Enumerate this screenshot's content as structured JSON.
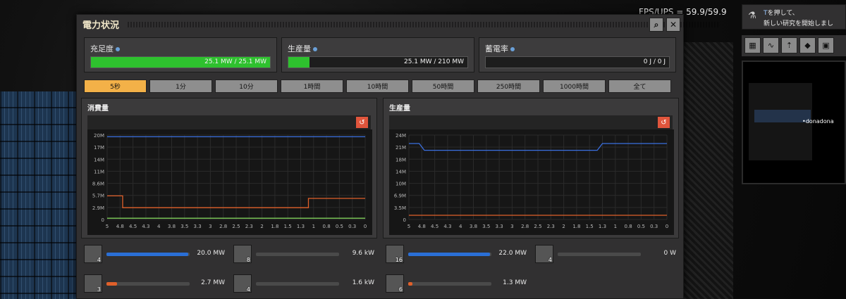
{
  "hud": {
    "fps": "FPS/UPS = 59.9/59.9"
  },
  "window": {
    "title": "電力状況",
    "search_icon": "search-icon",
    "close_icon": "close-icon"
  },
  "stats": {
    "satisfaction": {
      "label": "充足度",
      "value": "25.1 MW / 25.1 MW",
      "fill": 1.0
    },
    "production": {
      "label": "生産量",
      "value": "25.1 MW / 210 MW",
      "fill": 0.12
    },
    "accumulator": {
      "label": "蓄電率",
      "value": "0 J / 0 J",
      "fill": 0.0
    }
  },
  "tabs": [
    "5秒",
    "1分",
    "10分",
    "1時間",
    "10時間",
    "50時間",
    "250時間",
    "1000時間",
    "全て"
  ],
  "active_tab": 0,
  "consumption_graph": {
    "title": "消費量",
    "y_ticks": [
      "20M",
      "17M",
      "14M",
      "11M",
      "8.6M",
      "5.7M",
      "2.9M",
      "0"
    ],
    "x_ticks": [
      "5",
      "4.8",
      "4.5",
      "4.3",
      "4",
      "3.8",
      "3.5",
      "3.3",
      "3",
      "2.8",
      "2.5",
      "2.3",
      "2",
      "1.8",
      "1.5",
      "1.3",
      "1",
      "0.8",
      "0.5",
      "0.3",
      "0"
    ]
  },
  "production_graph": {
    "title": "生産量",
    "y_ticks": [
      "24M",
      "21M",
      "18M",
      "14M",
      "10M",
      "6.9M",
      "3.5M",
      "0"
    ],
    "x_ticks": [
      "5",
      "4.8",
      "4.5",
      "4.3",
      "4",
      "3.8",
      "3.5",
      "3.3",
      "3",
      "2.8",
      "2.5",
      "2.3",
      "2",
      "1.8",
      "1.5",
      "1.3",
      "1",
      "0.8",
      "0.5",
      "0.3",
      "0"
    ]
  },
  "consumers": [
    {
      "icon": "lab-icon",
      "count": "4",
      "value": "20.0 MW",
      "fill": 0.98,
      "color": "#2a6fd6"
    },
    {
      "icon": "inserter-icon",
      "count": "8",
      "value": "9.6 kW",
      "fill": 0.0,
      "color": "#2a6fd6"
    },
    {
      "icon": "radar-icon",
      "count": "3",
      "value": "2.7 MW",
      "fill": 0.13,
      "color": "#e0602a"
    },
    {
      "icon": "fast-inserter-icon",
      "count": "4",
      "value": "1.6 kW",
      "fill": 0.0,
      "color": "#e0602a"
    }
  ],
  "producers": [
    {
      "icon": "steam-engine-icon",
      "count": "16",
      "value": "22.0 MW",
      "fill": 0.98,
      "color": "#2a6fd6"
    },
    {
      "icon": "lab-icon",
      "count": "4",
      "value": "0 W",
      "fill": 0.0,
      "color": "#2a6fd6"
    },
    {
      "icon": "solar-panel-icon",
      "count": "6",
      "value": "1.3 MW",
      "fill": 0.05,
      "color": "#e0602a"
    }
  ],
  "research": {
    "key": "T",
    "line1": "を押して、",
    "line2": "新しい研究を開始しまし"
  },
  "toolbar_icons": [
    "production-stats-icon",
    "electric-network-icon",
    "tech-tree-icon",
    "achievements-icon",
    "train-icon"
  ],
  "minimap": {
    "player": "donadona"
  }
}
